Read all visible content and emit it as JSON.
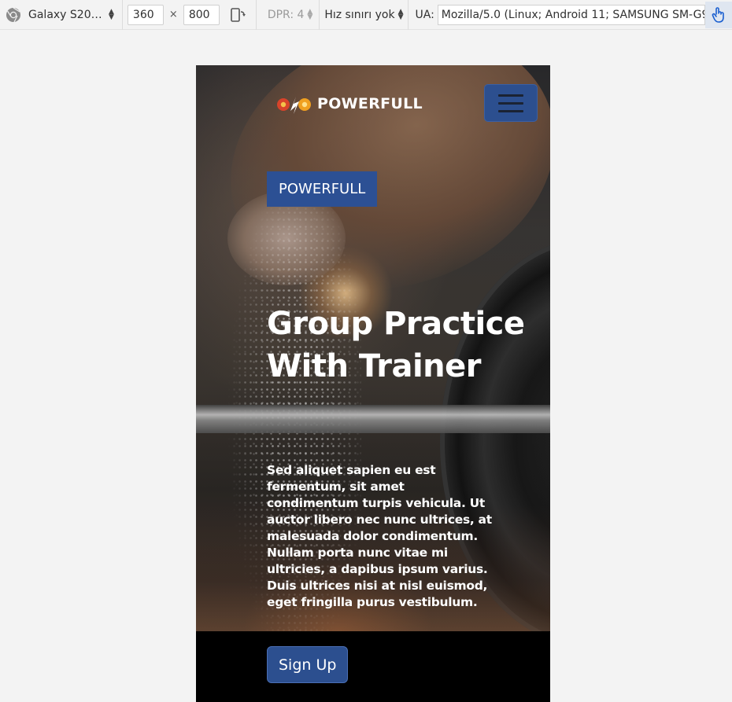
{
  "devtools": {
    "device_name": "Galaxy S20 A...",
    "width": "360",
    "times": "×",
    "height": "800",
    "dpr": "DPR: 4",
    "throttle": "Hız sınırı yok",
    "ua_label": "UA:",
    "ua_value": "Mozilla/5.0 (Linux; Android 11; SAMSUNG SM-G97"
  },
  "site": {
    "logo_text": "POWERFULL",
    "badge": "POWERFULL",
    "title": "Group  Practice\nWith Trainer",
    "description": "Sed aliquet sapien eu est fermentum, sit amet condimentum turpis vehicula. Ut auctor libero nec nunc ultrices, at malesuada dolor condimentum. Nullam porta nunc vitae mi ultricies, a dapibus ipsum varius. Duis ultrices nisi at nisl euismod, eget fringilla purus vestibulum.",
    "cta": "Sign Up"
  },
  "colors": {
    "accent": "#2c4f8f",
    "badge_bg": "#2c5094",
    "toolbar_bg": "#f3f3f3"
  },
  "icons": [
    "chrome-icon",
    "rotate-device-icon",
    "touch-icon",
    "hamburger-menu-icon",
    "logo-icon"
  ]
}
